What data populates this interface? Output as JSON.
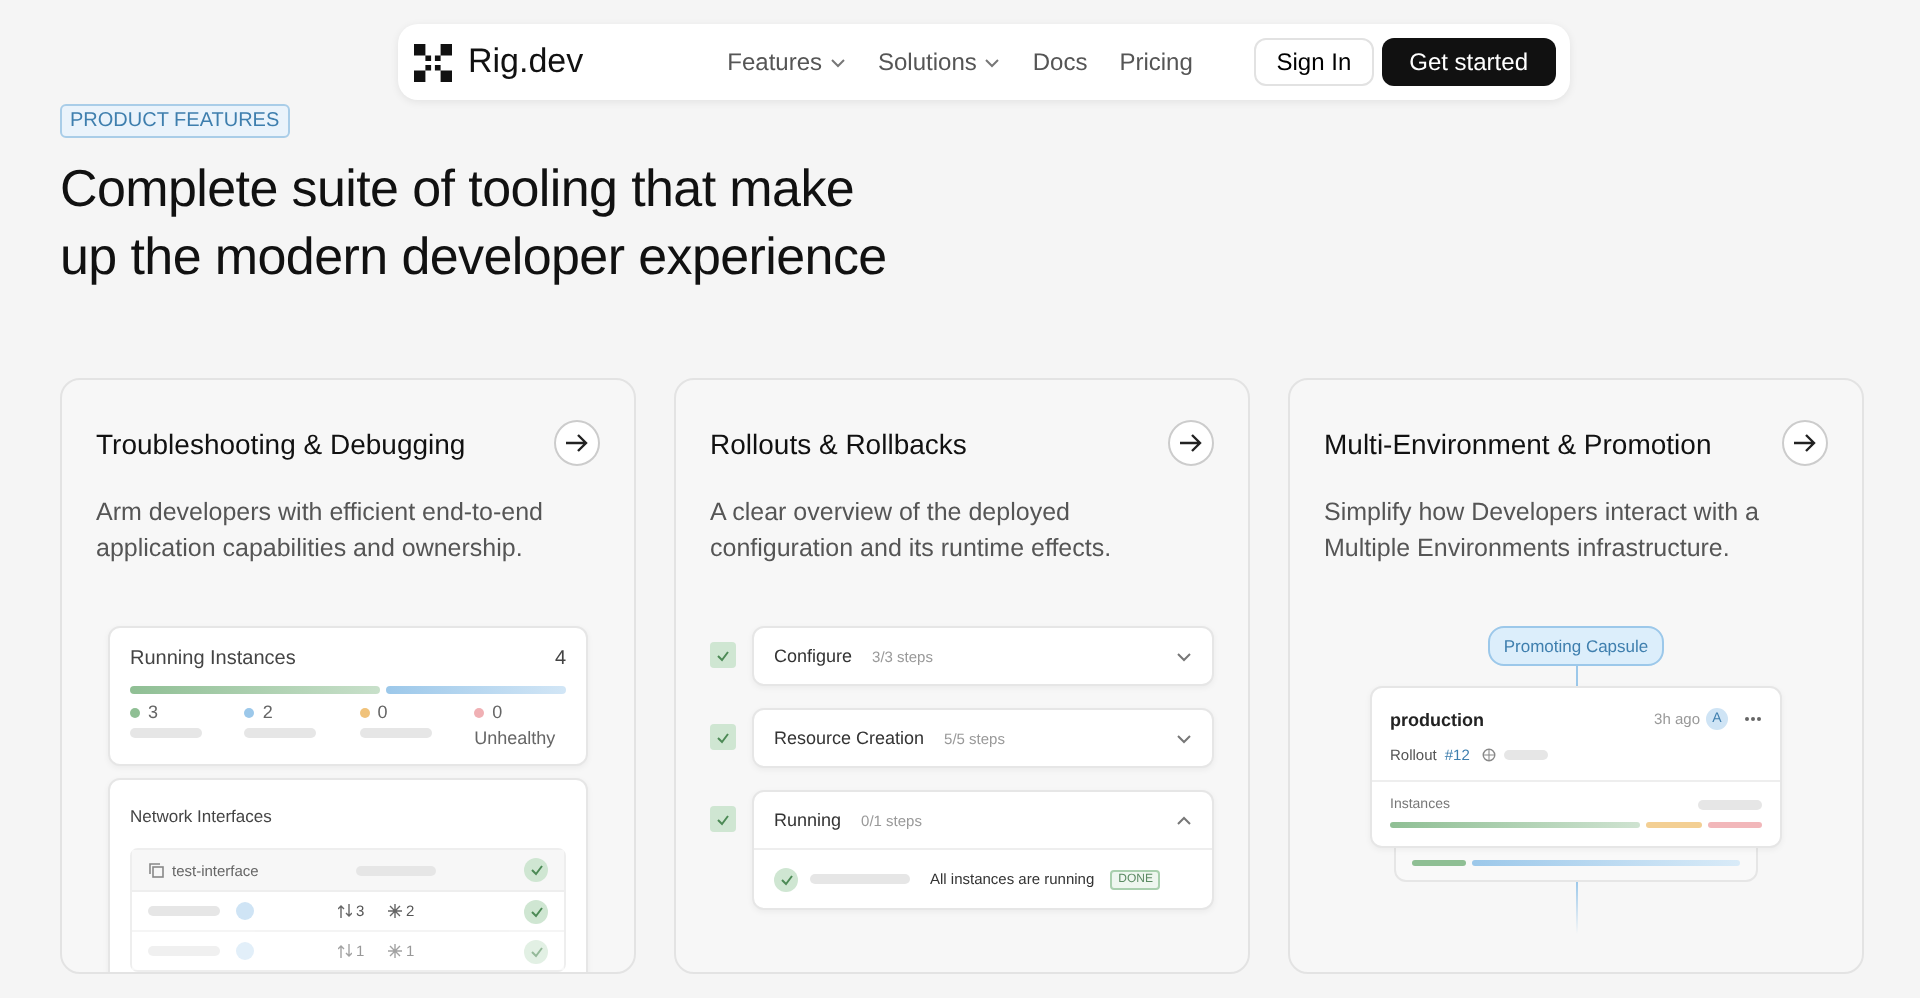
{
  "nav": {
    "brand": "Rig.dev",
    "links": [
      {
        "label": "Features",
        "dropdown": true
      },
      {
        "label": "Solutions",
        "dropdown": true
      },
      {
        "label": "Docs",
        "dropdown": false
      },
      {
        "label": "Pricing",
        "dropdown": false
      }
    ],
    "sign_in": "Sign In",
    "cta": "Get started"
  },
  "eyebrow": "PRODUCT FEATURES",
  "heading": "Complete suite of tooling that make up the modern developer experience",
  "cards": [
    {
      "kind": "instances",
      "title": "Troubleshooting & Debugging",
      "description": "Arm developers with efficient end-to-end application capabilities and ownership.",
      "panel": {
        "title": "Running Instances",
        "count": "4",
        "stats": [
          {
            "value": "3",
            "color": "#8fbf94"
          },
          {
            "value": "2",
            "color": "#9cc8ea"
          },
          {
            "value": "0",
            "color": "#f0c27a"
          },
          {
            "value": "0",
            "color": "#f0b0b4",
            "label": "Unhealthy"
          }
        ]
      },
      "network": {
        "title": "Network Interfaces",
        "rows": [
          {
            "name": "test-interface",
            "ok": true
          },
          {
            "a": "3",
            "b": "2",
            "ok": true
          },
          {
            "a": "1",
            "b": "1",
            "ok": true
          }
        ]
      }
    },
    {
      "kind": "rollout",
      "title": "Rollouts & Rollbacks",
      "description": "A clear overview of the deployed configuration and its runtime effects.",
      "steps": [
        {
          "label": "Configure",
          "count": "3/3 steps",
          "expanded": false
        },
        {
          "label": "Resource Creation",
          "count": "5/5 steps",
          "expanded": false
        },
        {
          "label": "Running",
          "count": "0/1 steps",
          "expanded": true,
          "detail": "All instances are running",
          "status": "DONE"
        }
      ]
    },
    {
      "kind": "promotion",
      "title": "Multi-Environment & Promotion",
      "description": "Simplify how Developers interact with a Multiple Environments infrastructure.",
      "tag": "Promoting Capsule",
      "env": "production",
      "time": "3h ago",
      "avatar": "A",
      "rollout": "Rollout",
      "rollout_id": "#12",
      "instances": "Instances"
    }
  ]
}
